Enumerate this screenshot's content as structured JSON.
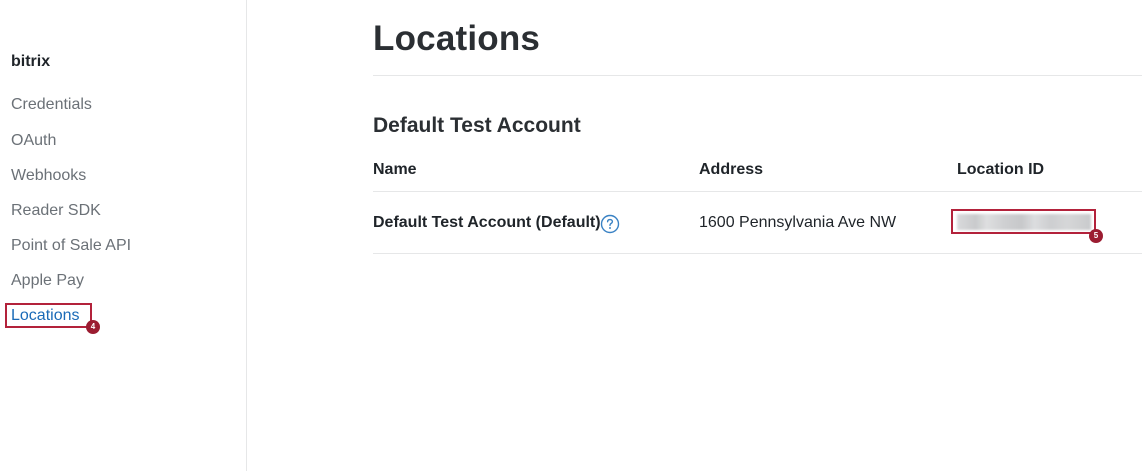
{
  "sidebar": {
    "app_name": "bitrix",
    "items": [
      {
        "label": "Credentials"
      },
      {
        "label": "OAuth"
      },
      {
        "label": "Webhooks"
      },
      {
        "label": "Reader SDK"
      },
      {
        "label": "Point of Sale API"
      },
      {
        "label": "Apple Pay"
      },
      {
        "label": "Locations",
        "active": true
      }
    ]
  },
  "annotations": {
    "locations_marker": "4",
    "location_id_marker": "5",
    "marker_color": "#9b1c31"
  },
  "main": {
    "title": "Locations",
    "section_title": "Default Test Account",
    "table": {
      "columns": [
        "Name",
        "Address",
        "Location ID"
      ],
      "rows": [
        {
          "name": "Default Test Account (Default)",
          "address": "1600 Pennsylvania Ave NW",
          "location_id": "",
          "help_icon": "question-circle-icon"
        }
      ]
    }
  },
  "colors": {
    "active_link": "#1a6ab7",
    "muted_text": "#6b7177",
    "help_icon": "#3a82c4"
  }
}
